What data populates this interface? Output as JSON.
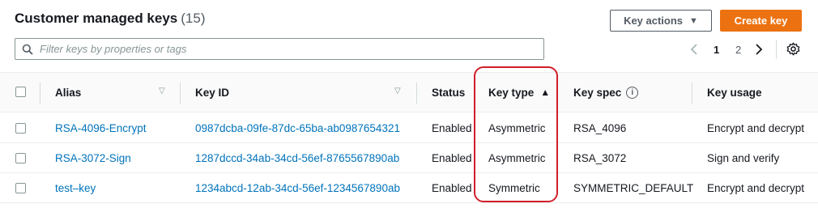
{
  "header": {
    "title": "Customer managed keys",
    "count": "(15)"
  },
  "actions": {
    "key_actions_label": "Key actions",
    "create_key_label": "Create key"
  },
  "filter": {
    "placeholder": "Filter keys by properties or tags"
  },
  "pagination": {
    "pages": [
      "1",
      "2"
    ],
    "current": "1"
  },
  "columns": {
    "alias": "Alias",
    "key_id": "Key ID",
    "status": "Status",
    "key_type": "Key type",
    "key_spec": "Key spec",
    "key_usage": "Key usage"
  },
  "sort": {
    "column": "key_type",
    "direction": "ascending"
  },
  "rows": [
    {
      "alias": "RSA-4096-Encrypt",
      "key_id": "0987dcba-09fe-87dc-65ba-ab0987654321",
      "status": "Enabled",
      "key_type": "Asymmetric",
      "key_spec": "RSA_4096",
      "key_usage": "Encrypt and decrypt"
    },
    {
      "alias": "RSA-3072-Sign",
      "key_id": "1287dccd-34ab-34cd-56ef-8765567890ab",
      "status": "Enabled",
      "key_type": "Asymmetric",
      "key_spec": "RSA_3072",
      "key_usage": "Sign and verify"
    },
    {
      "alias": "test–key",
      "key_id": "1234abcd-12ab-34cd-56ef-1234567890ab",
      "status": "Enabled",
      "key_type": "Symmetric",
      "key_spec": "SYMMETRIC_DEFAULT",
      "key_usage": "Encrypt and decrypt"
    }
  ],
  "colors": {
    "link": "#0073bb",
    "primary": "#ec7211",
    "highlight": "#d21e2b"
  }
}
